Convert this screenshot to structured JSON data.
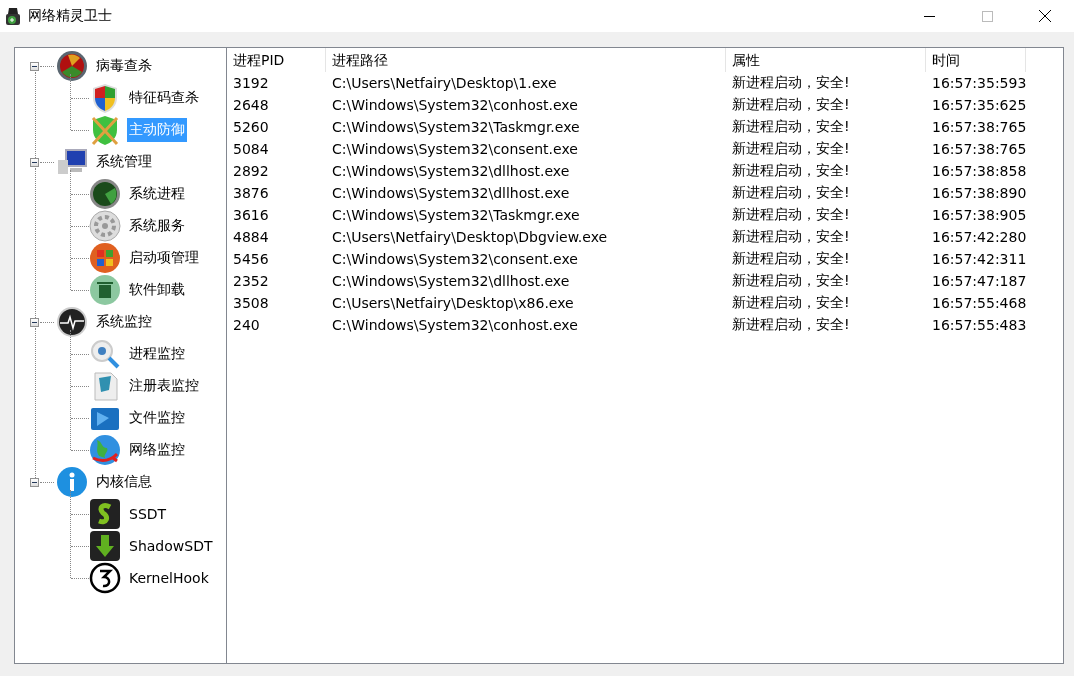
{
  "window": {
    "title": "网络精灵卫士"
  },
  "tree": [
    {
      "label": "病毒查杀",
      "expanded": true,
      "selected": false,
      "children": [
        {
          "label": "特征码查杀",
          "selected": false
        },
        {
          "label": "主动防御",
          "selected": true
        }
      ]
    },
    {
      "label": "系统管理",
      "expanded": true,
      "selected": false,
      "children": [
        {
          "label": "系统进程",
          "selected": false
        },
        {
          "label": "系统服务",
          "selected": false
        },
        {
          "label": "启动项管理",
          "selected": false
        },
        {
          "label": "软件卸载",
          "selected": false
        }
      ]
    },
    {
      "label": "系统监控",
      "expanded": true,
      "selected": false,
      "children": [
        {
          "label": "进程监控",
          "selected": false
        },
        {
          "label": "注册表监控",
          "selected": false
        },
        {
          "label": "文件监控",
          "selected": false
        },
        {
          "label": "网络监控",
          "selected": false
        }
      ]
    },
    {
      "label": "内核信息",
      "expanded": true,
      "selected": false,
      "children": [
        {
          "label": "SSDT",
          "selected": false
        },
        {
          "label": "ShadowSDT",
          "selected": false
        },
        {
          "label": "KernelHook",
          "selected": false
        }
      ]
    }
  ],
  "table": {
    "columns": [
      "进程PID",
      "进程路径",
      "属性",
      "时间"
    ],
    "rows": [
      [
        "3192",
        "C:\\Users\\Netfairy\\Desktop\\1.exe",
        "新进程启动，安全!",
        "16:57:35:593"
      ],
      [
        "2648",
        "C:\\Windows\\System32\\conhost.exe",
        "新进程启动，安全!",
        "16:57:35:625"
      ],
      [
        "5260",
        "C:\\Windows\\System32\\Taskmgr.exe",
        "新进程启动，安全!",
        "16:57:38:765"
      ],
      [
        "5084",
        "C:\\Windows\\System32\\consent.exe",
        "新进程启动，安全!",
        "16:57:38:765"
      ],
      [
        "2892",
        "C:\\Windows\\System32\\dllhost.exe",
        "新进程启动，安全!",
        "16:57:38:858"
      ],
      [
        "3876",
        "C:\\Windows\\System32\\dllhost.exe",
        "新进程启动，安全!",
        "16:57:38:890"
      ],
      [
        "3616",
        "C:\\Windows\\System32\\Taskmgr.exe",
        "新进程启动，安全!",
        "16:57:38:905"
      ],
      [
        "4884",
        "C:\\Users\\Netfairy\\Desktop\\Dbgview.exe",
        "新进程启动，安全!",
        "16:57:42:280"
      ],
      [
        "5456",
        "C:\\Windows\\System32\\consent.exe",
        "新进程启动，安全!",
        "16:57:42:311"
      ],
      [
        "2352",
        "C:\\Windows\\System32\\dllhost.exe",
        "新进程启动，安全!",
        "16:57:47:187"
      ],
      [
        "3508",
        "C:\\Users\\Netfairy\\Desktop\\x86.exe",
        "新进程启动，安全!",
        "16:57:55:468"
      ],
      [
        "240",
        "C:\\Windows\\System32\\conhost.exe",
        "新进程启动，安全!",
        "16:57:55:483"
      ]
    ]
  }
}
